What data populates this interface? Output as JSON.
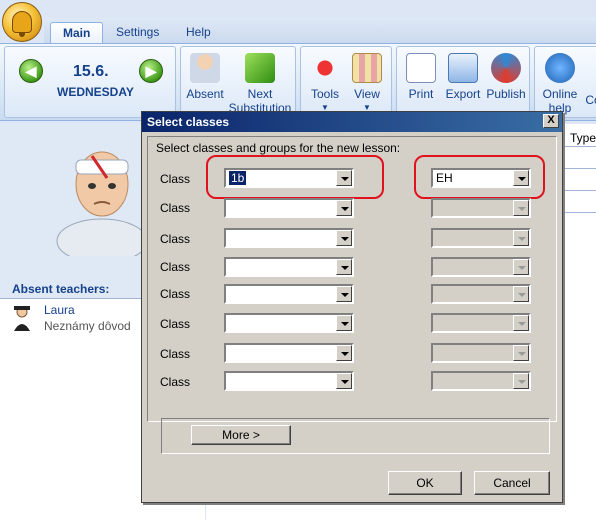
{
  "tabs": [
    {
      "label": "Main",
      "active": true
    },
    {
      "label": "Settings",
      "active": false
    },
    {
      "label": "Help",
      "active": false
    }
  ],
  "date": {
    "main": "15.6.",
    "day": "WEDNESDAY"
  },
  "ribbon_buttons": {
    "absent": "Absent",
    "next_substitution": "Next Substitution",
    "tools": "Tools",
    "view": "View",
    "print": "Print",
    "export": "Export",
    "publish": "Publish",
    "online_help": "Online help",
    "cut_label": "Co"
  },
  "left_panel": {
    "absent_title": "Absent teachers:",
    "teacher_name": "Laura",
    "teacher_reason": "Neznámy dôvod"
  },
  "grid": {
    "header_fragment": "Type"
  },
  "dialog": {
    "title": "Select classes",
    "prompt": "Select classes and groups for the new lesson:",
    "row_label": "Class",
    "rows": [
      {
        "class_value": "1b",
        "group_value": "EH",
        "group_enabled": true
      },
      {
        "class_value": "",
        "group_value": "",
        "group_enabled": false
      },
      {
        "class_value": "",
        "group_value": "",
        "group_enabled": false
      },
      {
        "class_value": "",
        "group_value": "",
        "group_enabled": false
      },
      {
        "class_value": "",
        "group_value": "",
        "group_enabled": false
      },
      {
        "class_value": "",
        "group_value": "",
        "group_enabled": false
      },
      {
        "class_value": "",
        "group_value": "",
        "group_enabled": false
      },
      {
        "class_value": "",
        "group_value": "",
        "group_enabled": false
      }
    ],
    "more_button": "More >",
    "ok_button": "OK",
    "cancel_button": "Cancel",
    "close_glyph": "X"
  },
  "colors": {
    "highlight": "#e0121e",
    "ribbon_text": "#15428b",
    "titlebar": "#0a246a"
  }
}
